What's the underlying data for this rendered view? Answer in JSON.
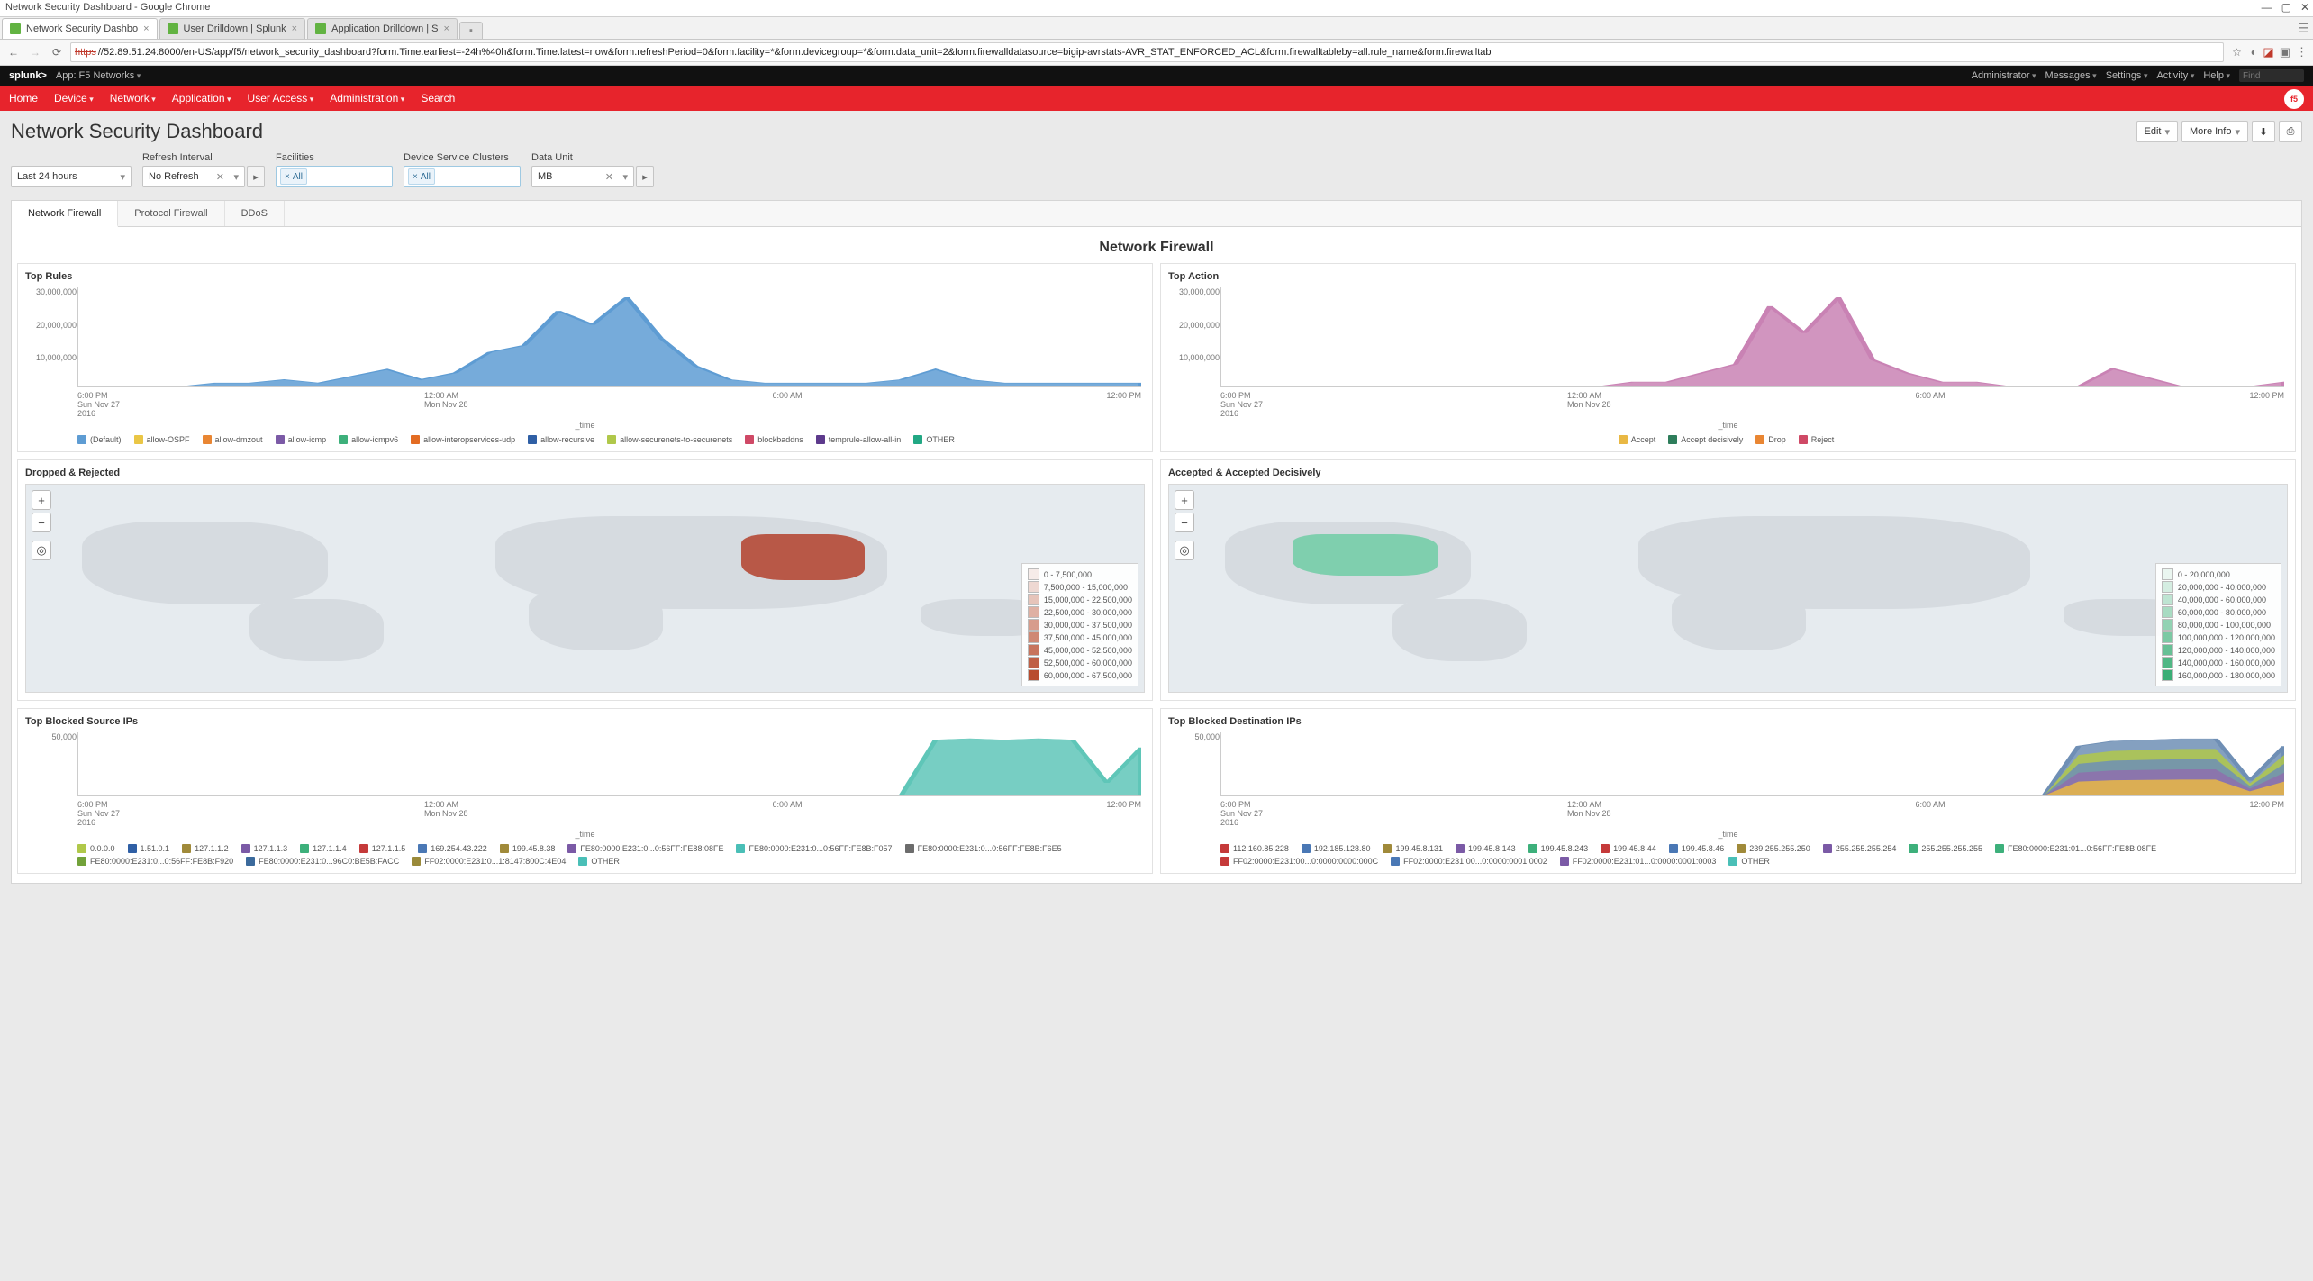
{
  "window": {
    "title": "Network Security Dashboard - Google Chrome"
  },
  "browser_tabs": [
    {
      "label": "Network Security Dashbo",
      "active": true
    },
    {
      "label": "User Drilldown | Splunk",
      "active": false
    },
    {
      "label": "Application Drilldown | S",
      "active": false
    }
  ],
  "address_bar": {
    "protocol": "https",
    "url": "//52.89.51.24:8000/en-US/app/f5/network_security_dashboard?form.Time.earliest=-24h%40h&form.Time.latest=now&form.refreshPeriod=0&form.facility=*&form.devicegroup=*&form.data_unit=2&form.firewalldatasource=bigip-avrstats-AVR_STAT_ENFORCED_ACL&form.firewalltableby=all.rule_name&form.firewalltab"
  },
  "splunk_header": {
    "brand": "splunk>",
    "app_label": "App: F5 Networks",
    "right": [
      "Administrator",
      "Messages",
      "Settings",
      "Activity",
      "Help"
    ],
    "find_placeholder": "Find"
  },
  "app_nav": [
    "Home",
    "Device",
    "Network",
    "Application",
    "User Access",
    "Administration",
    "Search"
  ],
  "dashboard": {
    "title": "Network Security Dashboard",
    "buttons": {
      "edit": "Edit",
      "more_info": "More Info"
    },
    "filters": {
      "time": {
        "value": "Last 24 hours"
      },
      "refresh": {
        "label": "Refresh Interval",
        "value": "No Refresh"
      },
      "facilities": {
        "label": "Facilities",
        "token": "All"
      },
      "dsc": {
        "label": "Device Service Clusters",
        "token": "All"
      },
      "data_unit": {
        "label": "Data Unit",
        "value": "MB"
      }
    },
    "tabs": [
      "Network Firewall",
      "Protocol Firewall",
      "DDoS"
    ],
    "section_title": "Network Firewall"
  },
  "chart_data": [
    {
      "id": "top_rules",
      "title": "Top Rules",
      "type": "area",
      "xlabel": "_time",
      "yticks": [
        "10,000,000",
        "20,000,000",
        "30,000,000"
      ],
      "xticks": [
        {
          "t": "6:00 PM",
          "sub1": "Sun Nov 27",
          "sub2": "2016"
        },
        {
          "t": "12:00 AM",
          "sub1": "Mon Nov 28",
          "sub2": ""
        },
        {
          "t": "6:00 AM",
          "sub1": "",
          "sub2": ""
        },
        {
          "t": "12:00 PM",
          "sub1": "",
          "sub2": ""
        }
      ],
      "legend": [
        {
          "name": "(Default)",
          "color": "#5e9cd3"
        },
        {
          "name": "allow-OSPF",
          "color": "#eac645"
        },
        {
          "name": "allow-dmzout",
          "color": "#e98633"
        },
        {
          "name": "allow-icmp",
          "color": "#7b5aa6"
        },
        {
          "name": "allow-icmpv6",
          "color": "#3db07b"
        },
        {
          "name": "allow-interopservices-udp",
          "color": "#e36c23"
        },
        {
          "name": "allow-recursive",
          "color": "#2f5fa5"
        },
        {
          "name": "allow-securenets-to-securenets",
          "color": "#b0c84a"
        },
        {
          "name": "blockbaddns",
          "color": "#cf4966"
        },
        {
          "name": "temprule-allow-all-in",
          "color": "#5d3a8c"
        },
        {
          "name": "OTHER",
          "color": "#22a884"
        }
      ],
      "series_shape": [
        0,
        0,
        0,
        0,
        1,
        1,
        2,
        1,
        3,
        5,
        2,
        4,
        10,
        12,
        22,
        18,
        26,
        14,
        6,
        2,
        1,
        1,
        1,
        1,
        2,
        5,
        2,
        1,
        1,
        1,
        1,
        1
      ],
      "primary_color": "#5e9cd3"
    },
    {
      "id": "top_action",
      "title": "Top Action",
      "type": "area",
      "xlabel": "_time",
      "yticks": [
        "10,000,000",
        "20,000,000",
        "30,000,000"
      ],
      "xticks": [
        {
          "t": "6:00 PM",
          "sub1": "Sun Nov 27",
          "sub2": "2016"
        },
        {
          "t": "12:00 AM",
          "sub1": "Mon Nov 28",
          "sub2": ""
        },
        {
          "t": "6:00 AM",
          "sub1": "",
          "sub2": ""
        },
        {
          "t": "12:00 PM",
          "sub1": "",
          "sub2": ""
        }
      ],
      "legend": [
        {
          "name": "Accept",
          "color": "#e9b844"
        },
        {
          "name": "Accept decisively",
          "color": "#2e7d5b"
        },
        {
          "name": "Drop",
          "color": "#e98633"
        },
        {
          "name": "Reject",
          "color": "#cf4966"
        }
      ],
      "series_shape": [
        0,
        0,
        0,
        0,
        0,
        0,
        0,
        0,
        0,
        0,
        0,
        0,
        1,
        1,
        3,
        5,
        18,
        12,
        20,
        6,
        3,
        1,
        1,
        0,
        0,
        0,
        4,
        2,
        0,
        0,
        0,
        1
      ],
      "primary_color": "#c982b4"
    },
    {
      "id": "top_blocked_src",
      "title": "Top Blocked Source IPs",
      "type": "area",
      "xlabel": "_time",
      "yticks": [
        "50,000"
      ],
      "xticks": [
        {
          "t": "6:00 PM",
          "sub1": "Sun Nov 27",
          "sub2": "2016"
        },
        {
          "t": "12:00 AM",
          "sub1": "Mon Nov 28",
          "sub2": ""
        },
        {
          "t": "6:00 AM",
          "sub1": "",
          "sub2": ""
        },
        {
          "t": "12:00 PM",
          "sub1": "",
          "sub2": ""
        }
      ],
      "legend": [
        {
          "name": "0.0.0.0",
          "color": "#b0c84a"
        },
        {
          "name": "1.51.0.1",
          "color": "#2f5fa5"
        },
        {
          "name": "127.1.1.2",
          "color": "#a08a3a"
        },
        {
          "name": "127.1.1.3",
          "color": "#7b5aa6"
        },
        {
          "name": "127.1.1.4",
          "color": "#3db07b"
        },
        {
          "name": "127.1.1.5",
          "color": "#c53a3a"
        },
        {
          "name": "169.254.43.222",
          "color": "#4a78b5"
        },
        {
          "name": "199.45.8.38",
          "color": "#a08a3a"
        },
        {
          "name": "FE80:0000:E231:0...0:56FF:FE88:08FE",
          "color": "#7b5aa6"
        },
        {
          "name": "FE80:0000:E231:0...0:56FF:FE8B:F057",
          "color": "#4abfb7"
        },
        {
          "name": "FE80:0000:E231:0...0:56FF:FE8B:F6E5",
          "color": "#6c6c6c"
        },
        {
          "name": "FE80:0000:E231:0...0:56FF:FE8B:F920",
          "color": "#72a23a"
        },
        {
          "name": "FE80:0000:E231:0...96C0:BE5B:FACC",
          "color": "#3b6a9c"
        },
        {
          "name": "FF02:0000:E231:0...1:8147:800C:4E04",
          "color": "#9a8a3a"
        },
        {
          "name": "OTHER",
          "color": "#4abfb7"
        }
      ],
      "series_shape": [
        0,
        0,
        0,
        0,
        0,
        0,
        0,
        0,
        0,
        0,
        0,
        0,
        0,
        0,
        0,
        0,
        0,
        0,
        0,
        0,
        0,
        0,
        0,
        0,
        0,
        44,
        45,
        44,
        45,
        44,
        10,
        38
      ],
      "primary_color": "#5fc6b8"
    },
    {
      "id": "top_blocked_dst",
      "title": "Top Blocked Destination IPs",
      "type": "area",
      "xlabel": "_time",
      "yticks": [
        "50,000"
      ],
      "xticks": [
        {
          "t": "6:00 PM",
          "sub1": "Sun Nov 27",
          "sub2": "2016"
        },
        {
          "t": "12:00 AM",
          "sub1": "Mon Nov 28",
          "sub2": ""
        },
        {
          "t": "6:00 AM",
          "sub1": "",
          "sub2": ""
        },
        {
          "t": "12:00 PM",
          "sub1": "",
          "sub2": ""
        }
      ],
      "legend": [
        {
          "name": "112.160.85.228",
          "color": "#c53a3a"
        },
        {
          "name": "192.185.128.80",
          "color": "#4a78b5"
        },
        {
          "name": "199.45.8.131",
          "color": "#a08a3a"
        },
        {
          "name": "199.45.8.143",
          "color": "#7b5aa6"
        },
        {
          "name": "199.45.8.243",
          "color": "#3db07b"
        },
        {
          "name": "199.45.8.44",
          "color": "#c53a3a"
        },
        {
          "name": "199.45.8.46",
          "color": "#4a78b5"
        },
        {
          "name": "239.255.255.250",
          "color": "#a08a3a"
        },
        {
          "name": "255.255.255.254",
          "color": "#7b5aa6"
        },
        {
          "name": "255.255.255.255",
          "color": "#3db07b"
        },
        {
          "name": "FE80:0000:E231:01...0:56FF:FE8B:08FE",
          "color": "#3db07b"
        },
        {
          "name": "FF02:0000:E231:00...0:0000:0000:000C",
          "color": "#c53a3a"
        },
        {
          "name": "FF02:0000:E231:00...0:0000:0001:0002",
          "color": "#4a78b5"
        },
        {
          "name": "FF02:0000:E231:01...0:0000:0001:0003",
          "color": "#7b5aa6"
        },
        {
          "name": "OTHER",
          "color": "#4abfb7"
        }
      ],
      "series_shape": [
        0,
        0,
        0,
        0,
        0,
        0,
        0,
        0,
        0,
        0,
        0,
        0,
        0,
        0,
        0,
        0,
        0,
        0,
        0,
        0,
        0,
        0,
        0,
        0,
        0,
        40,
        44,
        45,
        46,
        46,
        12,
        40
      ],
      "primary_color": "#6f8fb5",
      "stack_colors": [
        "#b0c84a",
        "#6f8fb5",
        "#8e6fad",
        "#e9b844"
      ]
    }
  ],
  "maps": {
    "dropped": {
      "title": "Dropped & Rejected",
      "highlight_country": "China",
      "color_scale": "#b85847",
      "legend": [
        "0 - 7,500,000",
        "7,500,000 - 15,000,000",
        "15,000,000 - 22,500,000",
        "22,500,000 - 30,000,000",
        "30,000,000 - 37,500,000",
        "37,500,000 - 45,000,000",
        "45,000,000 - 52,500,000",
        "52,500,000 - 60,000,000",
        "60,000,000 - 67,500,000"
      ],
      "legend_colors": [
        "#f6ece9",
        "#eed8d2",
        "#e6c4ba",
        "#dfb0a3",
        "#d79c8c",
        "#cf8874",
        "#c7745d",
        "#bf6046",
        "#b84c2e"
      ]
    },
    "accepted": {
      "title": "Accepted & Accepted Decisively",
      "highlight_country": "United States",
      "color_scale": "#6fc8a3",
      "legend": [
        "0 - 20,000,000",
        "20,000,000 - 40,000,000",
        "40,000,000 - 60,000,000",
        "60,000,000 - 80,000,000",
        "80,000,000 - 100,000,000",
        "100,000,000 - 120,000,000",
        "120,000,000 - 140,000,000",
        "140,000,000 - 160,000,000",
        "160,000,000 - 180,000,000"
      ],
      "legend_colors": [
        "#eaf6f0",
        "#d4ede1",
        "#bee4d2",
        "#a8dbc2",
        "#92d2b3",
        "#7cc9a4",
        "#66c095",
        "#50b785",
        "#3aae76"
      ]
    }
  }
}
